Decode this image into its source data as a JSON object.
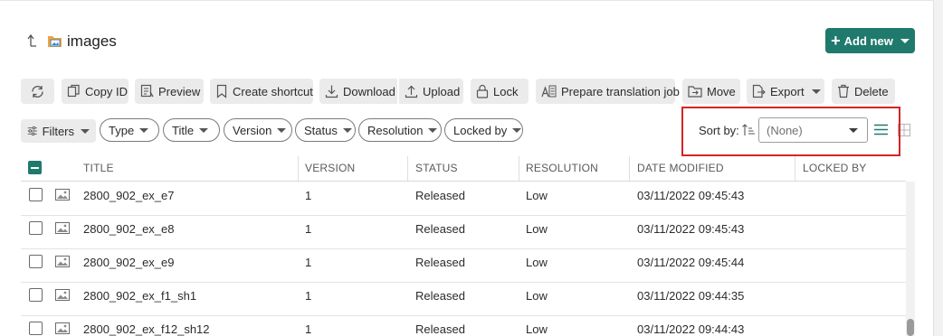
{
  "header": {
    "title": "images",
    "add_new_label": "Add new"
  },
  "toolbar": {
    "refresh_label": "",
    "copy_id_label": "Copy ID",
    "preview_label": "Preview",
    "create_shortcut_label": "Create shortcut",
    "download_label": "Download",
    "upload_label": "Upload",
    "lock_label": "Lock",
    "prepare_translation_label": "Prepare translation job",
    "move_label": "Move",
    "export_label": "Export",
    "delete_label": "Delete"
  },
  "filters": {
    "filters_label": "Filters",
    "pills": [
      "Type",
      "Title",
      "Version",
      "Status",
      "Resolution",
      "Locked by"
    ]
  },
  "sort": {
    "label": "Sort by:",
    "selected": "(None)"
  },
  "table": {
    "columns": [
      "TITLE",
      "VERSION",
      "STATUS",
      "RESOLUTION",
      "DATE MODIFIED",
      "LOCKED BY"
    ],
    "rows": [
      {
        "title": "2800_902_ex_e7",
        "version": "1",
        "status": "Released",
        "resolution": "Low",
        "date_modified": "03/11/2022 09:45:43",
        "locked_by": ""
      },
      {
        "title": "2800_902_ex_e8",
        "version": "1",
        "status": "Released",
        "resolution": "Low",
        "date_modified": "03/11/2022 09:45:43",
        "locked_by": ""
      },
      {
        "title": "2800_902_ex_e9",
        "version": "1",
        "status": "Released",
        "resolution": "Low",
        "date_modified": "03/11/2022 09:45:44",
        "locked_by": ""
      },
      {
        "title": "2800_902_ex_f1_sh1",
        "version": "1",
        "status": "Released",
        "resolution": "Low",
        "date_modified": "03/11/2022 09:44:35",
        "locked_by": ""
      },
      {
        "title": "2800_902_ex_f12_sh12",
        "version": "1",
        "status": "Released",
        "resolution": "Low",
        "date_modified": "03/11/2022 09:44:43",
        "locked_by": ""
      }
    ]
  },
  "colors": {
    "accent": "#1f7a6d",
    "highlight": "#d62424"
  }
}
